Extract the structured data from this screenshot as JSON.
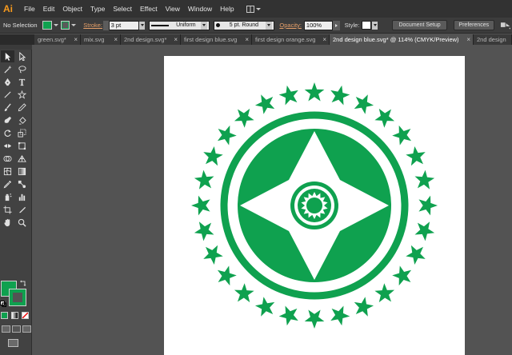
{
  "app": {
    "logo": "Ai",
    "accent_color": "#f79a1d"
  },
  "menu": [
    "File",
    "Edit",
    "Object",
    "Type",
    "Select",
    "Effect",
    "View",
    "Window",
    "Help"
  ],
  "control": {
    "selection": "No Selection",
    "fill_color": "#0fa14f",
    "stroke_label": "Stroke:",
    "stroke_weight": "3 pt",
    "profile": "Uniform",
    "brush": "5 pt. Round",
    "opacity_label": "Opacity:",
    "opacity": "100%",
    "style_label": "Style:",
    "document_setup": "Document Setup",
    "preferences": "Preferences"
  },
  "tabs": [
    {
      "label": "green.svg*",
      "active": false
    },
    {
      "label": "mix.svg",
      "active": false
    },
    {
      "label": "2nd design.svg*",
      "active": false
    },
    {
      "label": "first design blue.svg",
      "active": false
    },
    {
      "label": "first design orange.svg",
      "active": false
    },
    {
      "label": "2nd design blue.svg* @ 114% (CMYK/Preview)",
      "active": true
    },
    {
      "label": "2nd design",
      "active": false
    }
  ],
  "tab_close_glyph": "×",
  "artwork": {
    "primary_color": "#0fa14f",
    "background": "#ffffff"
  },
  "icons": [
    "selection-tool-icon",
    "direct-selection-tool-icon",
    "magic-wand-icon",
    "lasso-icon",
    "pen-icon",
    "type-icon",
    "line-icon",
    "star-icon",
    "paintbrush-icon",
    "pencil-icon",
    "blob-brush-icon",
    "eraser-icon",
    "rotate-icon",
    "scale-icon",
    "width-icon",
    "free-transform-icon",
    "shape-builder-icon",
    "perspective-grid-icon",
    "mesh-icon",
    "gradient-icon",
    "eyedropper-icon",
    "blend-icon",
    "symbol-sprayer-icon",
    "column-graph-icon",
    "artboard-icon",
    "slice-icon",
    "hand-icon",
    "zoom-icon"
  ]
}
